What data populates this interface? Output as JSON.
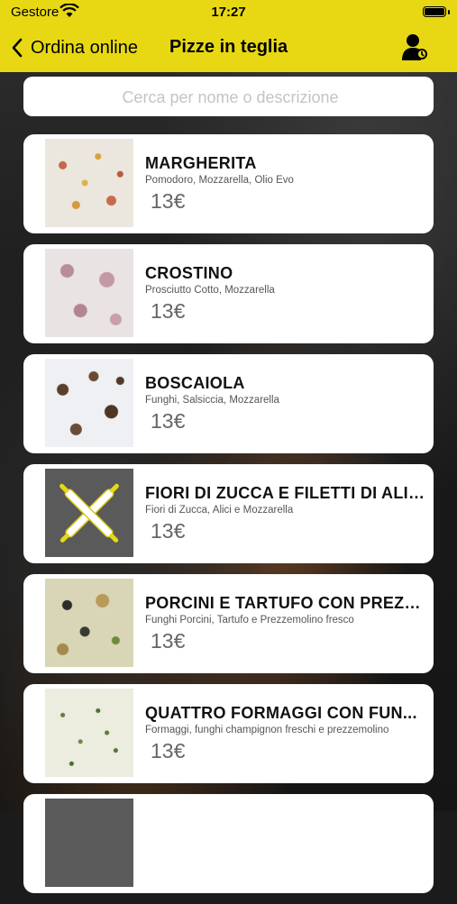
{
  "status_bar": {
    "carrier": "Gestore",
    "time": "17:27"
  },
  "nav": {
    "back_label": "Ordina online",
    "title": "Pizze in teglia"
  },
  "search": {
    "placeholder": "Cerca per nome o descrizione",
    "value": ""
  },
  "items": [
    {
      "name": "MARGHERITA",
      "description": "Pomodoro, Mozzarella, Olio Evo",
      "price": "13€",
      "image": "pizza-margherita"
    },
    {
      "name": "CROSTINO",
      "description": "Prosciutto Cotto, Mozzarella",
      "price": "13€",
      "image": "pizza-crostino"
    },
    {
      "name": "BOSCAIOLA",
      "description": "Funghi, Salsiccia, Mozzarella",
      "price": "13€",
      "image": "pizza-boscaiola"
    },
    {
      "name": "FIORI DI ZUCCA E FILETTI DI ALICI",
      "description": "Fiori di Zucca, Alici e Mozzarella",
      "price": "13€",
      "image": "rolling-pin-placeholder-icon"
    },
    {
      "name": "PORCINI E TARTUFO CON PREZZ...",
      "description": "Funghi Porcini, Tartufo e Prezzemolino fresco",
      "price": "13€",
      "image": "pizza-porcini"
    },
    {
      "name": "QUATTRO FORMAGGI CON FUN...",
      "description": "Formaggi, funghi champignon freschi e prezzemolino",
      "price": "13€",
      "image": "pizza-quattro-formaggi"
    }
  ],
  "colors": {
    "header": "#e8d814",
    "card": "#ffffff",
    "placeholder_accent": "#e8d814"
  }
}
